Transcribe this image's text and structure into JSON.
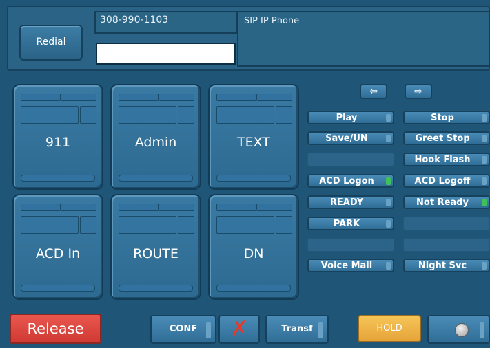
{
  "top": {
    "redial_label": "Redial",
    "number": "308-990-1103",
    "phone_type": "SIP IP Phone",
    "dial_input_value": ""
  },
  "tiles": [
    {
      "label": "911"
    },
    {
      "label": "Admin"
    },
    {
      "label": "TEXT"
    },
    {
      "label": "ACD In"
    },
    {
      "label": "ROUTE"
    },
    {
      "label": "DN"
    }
  ],
  "nav": {
    "left_arrow": "⇦",
    "right_arrow": "⇨"
  },
  "functions": {
    "play": "Play",
    "stop": "Stop",
    "save_un": "Save/UN",
    "greet_stop": "Greet Stop",
    "hook_flash": "Hook Flash",
    "acd_logon": "ACD Logon",
    "acd_logoff": "ACD Logoff",
    "ready": "READY",
    "not_ready": "Not Ready",
    "park": "PARK",
    "voice_mail": "Voice Mail",
    "night_svc": "Night Svc"
  },
  "bottom": {
    "release": "Release",
    "conf": "CONF",
    "cancel_symbol": "✗",
    "transf": "Transf",
    "hold": "HOLD"
  },
  "colors": {
    "background": "#1f5576",
    "release": "#d9443d",
    "hold": "#eeb34a",
    "indicator_green": "#3fc15a"
  }
}
